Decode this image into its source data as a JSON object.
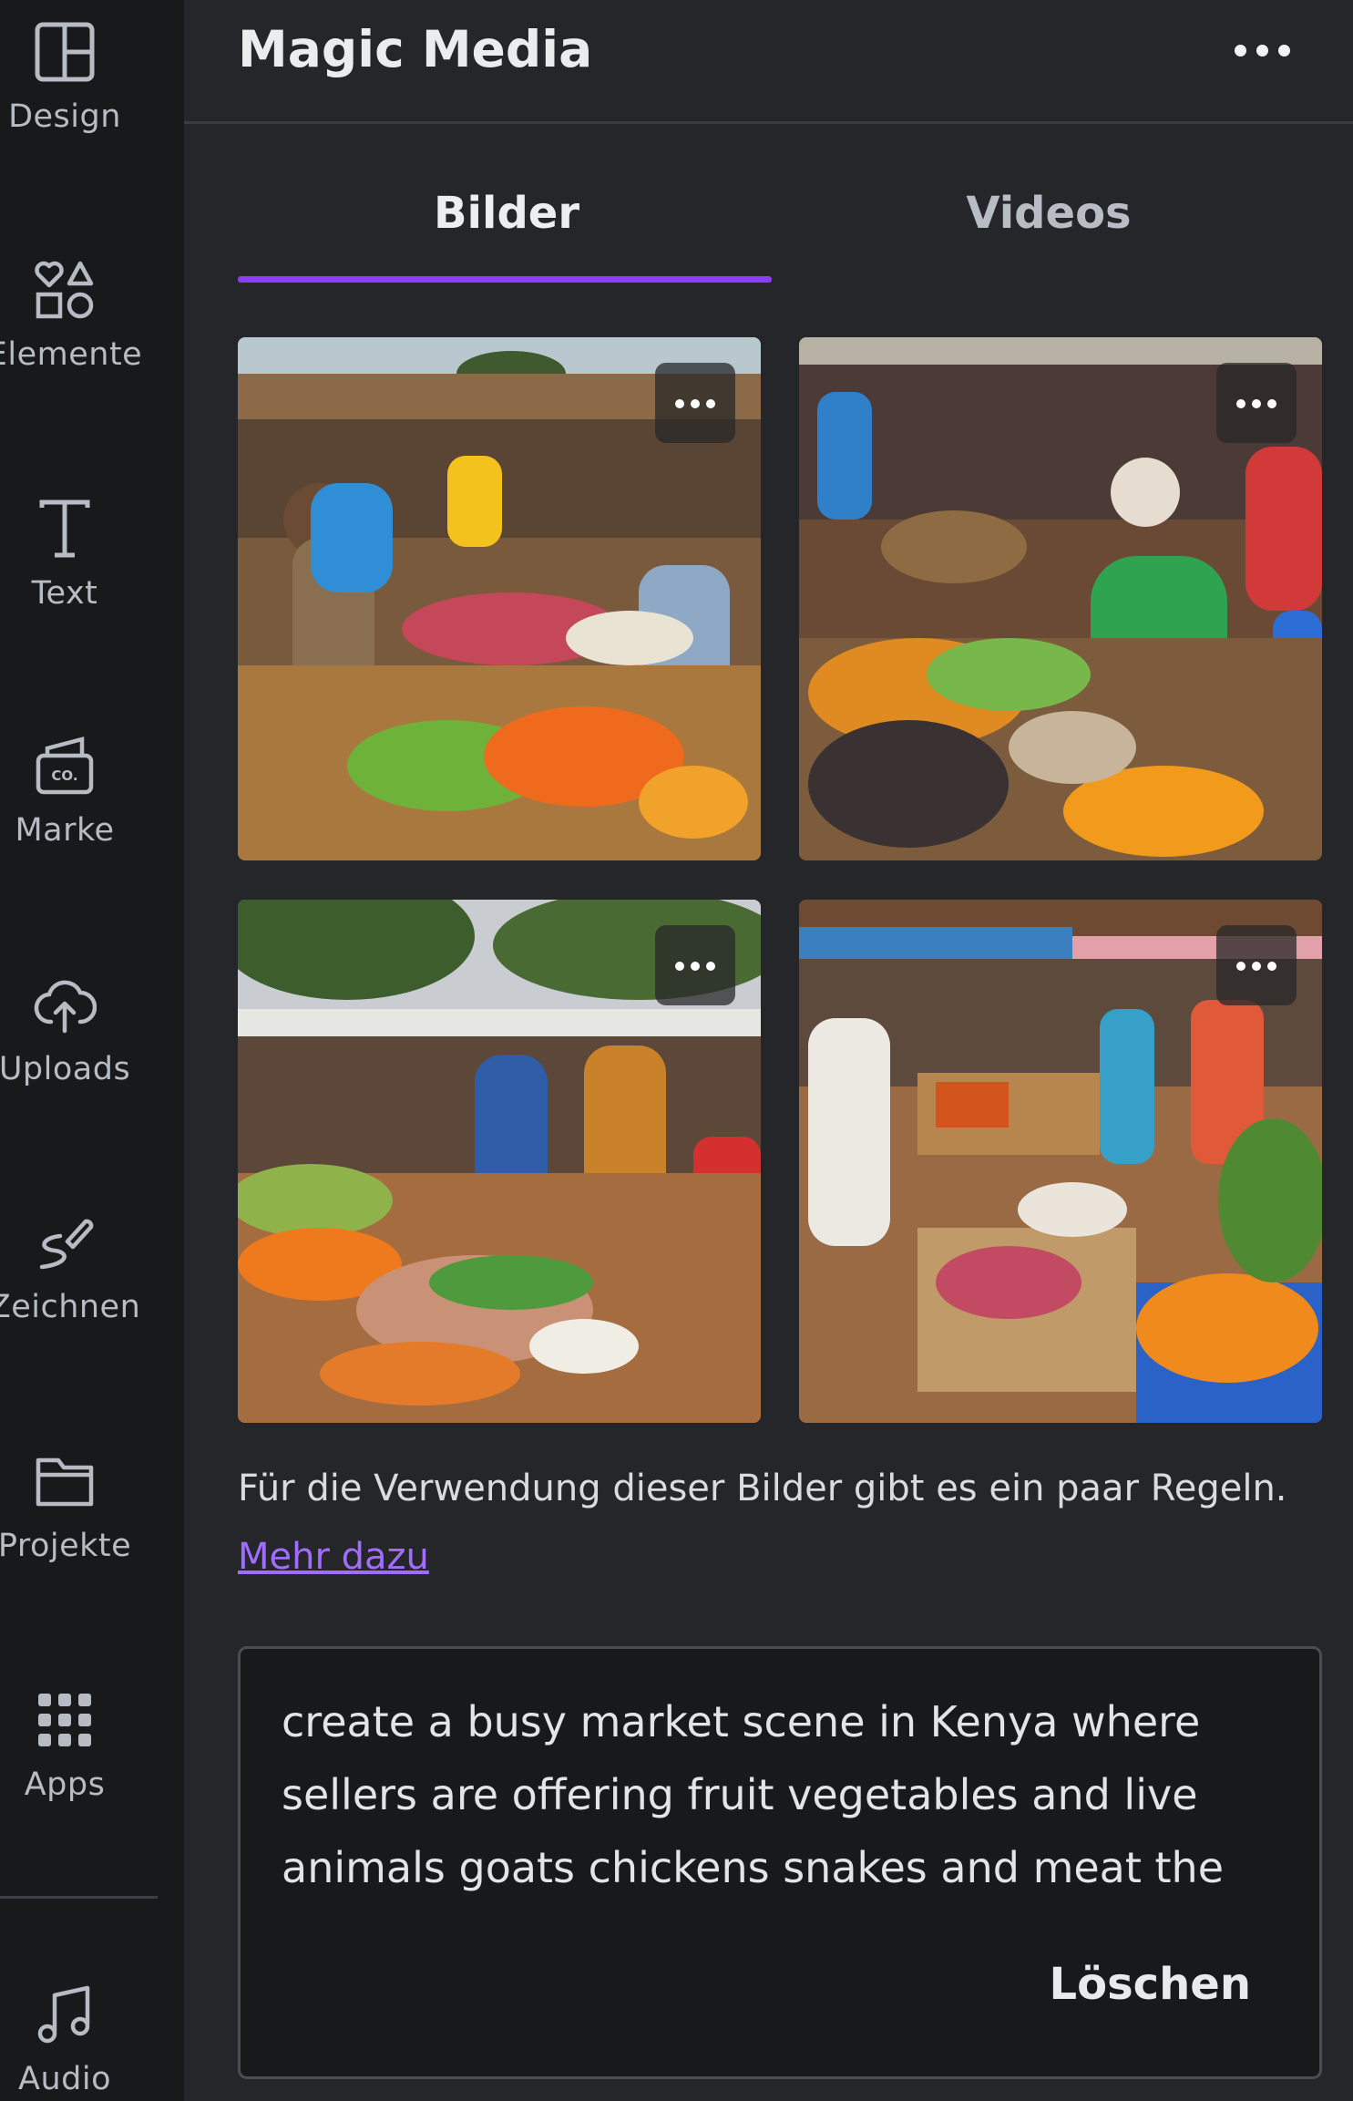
{
  "sidebar": {
    "items": [
      {
        "label": "Design",
        "icon": "layout-icon"
      },
      {
        "label": "Elemente",
        "icon": "shapes-icon"
      },
      {
        "label": "Text",
        "icon": "text-icon"
      },
      {
        "label": "Marke",
        "icon": "brand-icon"
      },
      {
        "label": "Uploads",
        "icon": "cloud-upload-icon"
      },
      {
        "label": "Zeichnen",
        "icon": "draw-icon"
      },
      {
        "label": "Projekte",
        "icon": "folder-icon"
      },
      {
        "label": "Apps",
        "icon": "apps-grid-icon"
      },
      {
        "label": "Audio",
        "icon": "music-note-icon"
      }
    ]
  },
  "panel": {
    "title": "Magic Media",
    "tabs": [
      {
        "label": "Bilder",
        "active": true
      },
      {
        "label": "Videos",
        "active": false
      }
    ],
    "accent_color": "#8b3dff",
    "link_color": "#a06dff",
    "images": [
      {
        "subject": "market scene with vegetables and tomatoes"
      },
      {
        "subject": "market scene with women selling produce"
      },
      {
        "subject": "open-air market under trees"
      },
      {
        "subject": "market stalls with crates of vegetables and oranges"
      }
    ],
    "notice": "Für die Verwendung dieser Bilder gibt es ein paar Regeln.",
    "more_link": "Mehr dazu",
    "prompt": "create a busy market scene in Kenya where sellers are offering fruit vegetables and live animals goats chickens snakes and meat the mood is lively and vibrant rich colours",
    "clear_label": "Löschen"
  }
}
